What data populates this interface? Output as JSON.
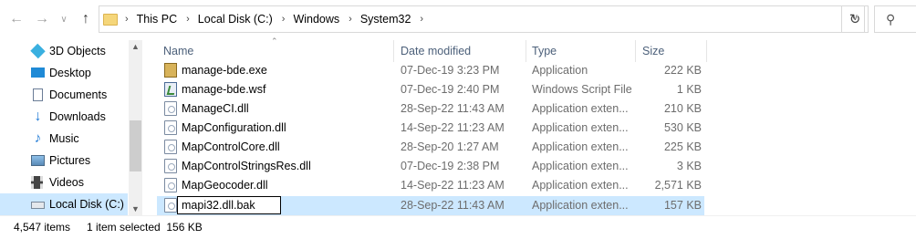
{
  "address": {
    "crumbs": [
      "This PC",
      "Local Disk (C:)",
      "Windows",
      "System32"
    ]
  },
  "nav": {
    "items": [
      {
        "label": "3D Objects",
        "icon": "3d-objects-icon",
        "color": "#3ab0e0"
      },
      {
        "label": "Desktop",
        "icon": "desktop-icon",
        "color": "#1f8ad6"
      },
      {
        "label": "Documents",
        "icon": "documents-icon",
        "color": "#6a7c96"
      },
      {
        "label": "Downloads",
        "icon": "downloads-icon",
        "color": "#1f7ad6"
      },
      {
        "label": "Music",
        "icon": "music-icon",
        "color": "#1f7ad6"
      },
      {
        "label": "Pictures",
        "icon": "pictures-icon",
        "color": "#5a8ab8"
      },
      {
        "label": "Videos",
        "icon": "videos-icon",
        "color": "#444444"
      },
      {
        "label": "Local Disk (C:)",
        "icon": "local-disk-icon",
        "color": "#7a8a9a"
      }
    ]
  },
  "columns": {
    "name": "Name",
    "date": "Date modified",
    "type": "Type",
    "size": "Size"
  },
  "files": [
    {
      "name": "manage-bde.exe",
      "date": "07-Dec-19 3:23 PM",
      "type": "Application",
      "size": "222 KB",
      "icon": "exe-icon"
    },
    {
      "name": "manage-bde.wsf",
      "date": "07-Dec-19 2:40 PM",
      "type": "Windows Script File",
      "size": "1 KB",
      "icon": "wsf-icon"
    },
    {
      "name": "ManageCI.dll",
      "date": "28-Sep-22 11:43 AM",
      "type": "Application exten...",
      "size": "210 KB",
      "icon": "dll-icon"
    },
    {
      "name": "MapConfiguration.dll",
      "date": "14-Sep-22 11:23 AM",
      "type": "Application exten...",
      "size": "530 KB",
      "icon": "dll-icon"
    },
    {
      "name": "MapControlCore.dll",
      "date": "28-Sep-20 1:27 AM",
      "type": "Application exten...",
      "size": "225 KB",
      "icon": "dll-icon"
    },
    {
      "name": "MapControlStringsRes.dll",
      "date": "07-Dec-19 2:38 PM",
      "type": "Application exten...",
      "size": "3 KB",
      "icon": "dll-icon"
    },
    {
      "name": "MapGeocoder.dll",
      "date": "14-Sep-22 11:23 AM",
      "type": "Application exten...",
      "size": "2,571 KB",
      "icon": "dll-icon"
    },
    {
      "name": "mapi32.dll.bak",
      "date": "28-Sep-22 11:43 AM",
      "type": "Application exten...",
      "size": "157 KB",
      "icon": "dll-icon"
    }
  ],
  "status": {
    "count": "4,547 items",
    "selection": "1 item selected  156 KB"
  }
}
